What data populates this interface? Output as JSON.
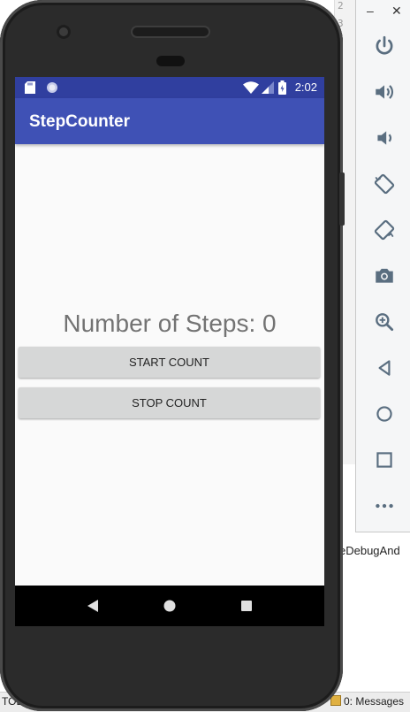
{
  "ide": {
    "line_numbers": [
      "2",
      "3"
    ],
    "side_text": "eDebugAnd",
    "bottom_left": "TODO",
    "bottom_right": "0: Messages"
  },
  "emulator_toolbar": {
    "minimize_label": "–",
    "close_label": "✕",
    "buttons": [
      "power-icon",
      "volume-up-icon",
      "volume-down-icon",
      "rotate-left-icon",
      "rotate-right-icon",
      "camera-icon",
      "zoom-icon",
      "back-icon",
      "home-icon",
      "overview-icon",
      "more-icon"
    ]
  },
  "device": {
    "status_bar": {
      "time": "2:02",
      "color": "#303f9f"
    },
    "app_bar": {
      "title": "StepCounter",
      "color": "#3f51b5"
    },
    "steps_text": "Number of Steps: 0",
    "start_button": "START COUNT",
    "stop_button": "STOP COUNT"
  }
}
